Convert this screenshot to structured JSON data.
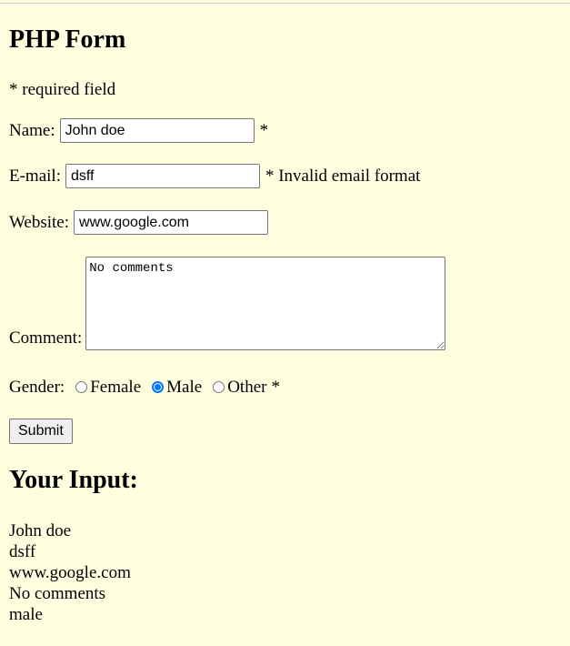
{
  "form": {
    "title": "PHP Form",
    "required_note": "* required field",
    "name": {
      "label": "Name:",
      "value": "John doe",
      "marker": "*"
    },
    "email": {
      "label": "E-mail:",
      "value": "dsff",
      "marker": "* Invalid email format"
    },
    "website": {
      "label": "Website:",
      "value": "www.google.com"
    },
    "comment": {
      "label": "Comment:",
      "value": "No comments"
    },
    "gender": {
      "label": "Gender:",
      "options": [
        {
          "label": "Female",
          "checked": false
        },
        {
          "label": "Male",
          "checked": true
        },
        {
          "label": "Other",
          "checked": false
        }
      ],
      "marker": "*"
    },
    "submit_label": "Submit"
  },
  "output": {
    "title": "Your Input:",
    "lines": [
      "John doe",
      "dsff",
      "www.google.com",
      "No comments",
      "male"
    ]
  }
}
